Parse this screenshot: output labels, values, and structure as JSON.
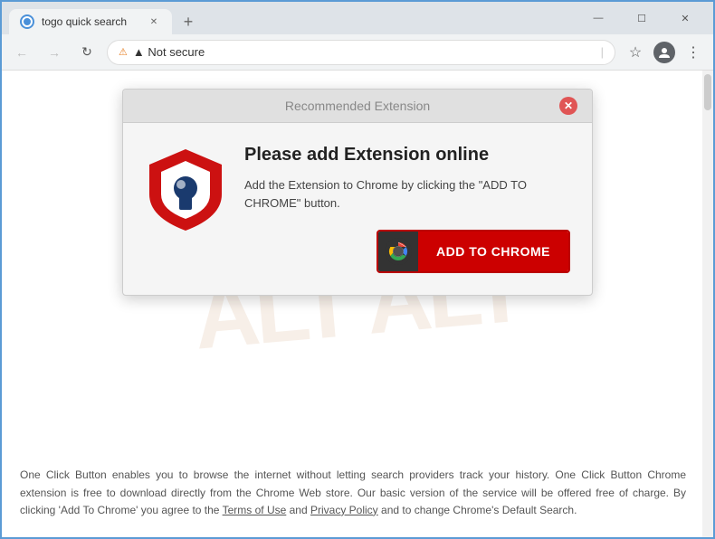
{
  "browser": {
    "tab_title": "togo quick search",
    "new_tab_label": "+",
    "window_controls": {
      "minimize": "—",
      "maximize": "☐",
      "close": "✕"
    },
    "nav": {
      "back": "←",
      "forward": "→",
      "refresh": "↻"
    },
    "address_bar": {
      "security_label": "▲ Not secure",
      "url": "",
      "divider": "|"
    },
    "toolbar": {
      "bookmark_icon": "☆",
      "profile_icon": "👤",
      "menu_icon": "⋮"
    }
  },
  "dialog": {
    "header_title": "Recommended Extension",
    "close_btn": "✕",
    "main_title": "Please add Extension online",
    "description": "Add the Extension to Chrome by clicking the \"ADD TO CHROME\" button.",
    "add_button_label": "ADD TO CHROME"
  },
  "page": {
    "footer_text": "One Click Button enables you to browse the internet without letting search providers track your history. One Click Button Chrome extension is free to download directly from the Chrome Web store. Our basic version of the service will be offered free of charge. By clicking 'Add To Chrome' you agree to the Terms of Use and Privacy Policy and to change Chrome's Default Search.",
    "terms_link": "Terms of Use",
    "privacy_link": "Privacy Policy"
  },
  "watermark": {
    "text": "ALT"
  }
}
